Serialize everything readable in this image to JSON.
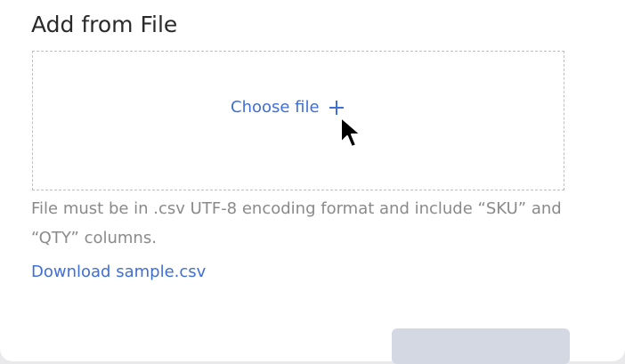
{
  "dialog": {
    "title": "Add from File",
    "dropzone": {
      "choose_label": "Choose file",
      "choose_icon": "plus-icon"
    },
    "hint": "File must be in .csv UTF-8 encoding format and include “SKU” and “QTY” columns.",
    "download_link": "Download sample.csv",
    "submit_label": ""
  },
  "colors": {
    "link": "#3f6fd6",
    "hint_text": "#8a8a8a",
    "title_text": "#2a2a2a",
    "disabled_button": "#d4d8e3"
  }
}
